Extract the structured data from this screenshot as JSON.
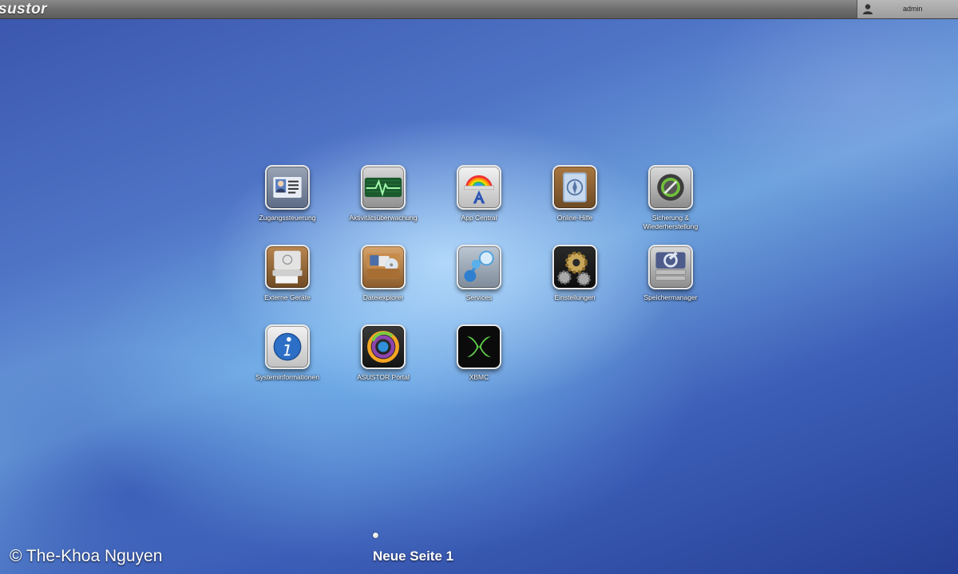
{
  "topbar": {
    "logo": "sustor",
    "user": "admin"
  },
  "apps": [
    {
      "label": "Zugangssteuerung",
      "icon": "contact-card-icon"
    },
    {
      "label": "Aktivitätsüberwachung",
      "icon": "activity-monitor-icon"
    },
    {
      "label": "App Central",
      "icon": "app-central-icon"
    },
    {
      "label": "Online-Hilfe",
      "icon": "online-help-icon"
    },
    {
      "label": "Sicherung & Wiederherstellung",
      "icon": "backup-restore-icon"
    },
    {
      "label": "Externe Geräte",
      "icon": "external-devices-icon"
    },
    {
      "label": "Dateiexplorer",
      "icon": "file-explorer-icon"
    },
    {
      "label": "Services",
      "icon": "services-icon"
    },
    {
      "label": "Einstellungen",
      "icon": "settings-gears-icon"
    },
    {
      "label": "Speichermanager",
      "icon": "storage-manager-icon"
    },
    {
      "label": "Systeminformationen",
      "icon": "info-icon"
    },
    {
      "label": "ASUSTOR Portal",
      "icon": "portal-icon"
    },
    {
      "label": "XBMC",
      "icon": "xbmc-icon"
    }
  ],
  "pager": {
    "label": "Neue Seite 1"
  },
  "watermark": {
    "text": "© The-Khoa Nguyen"
  }
}
